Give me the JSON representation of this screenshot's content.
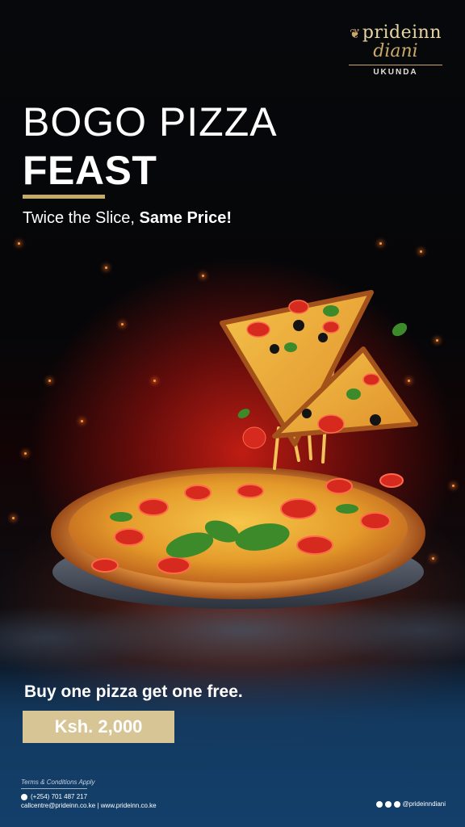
{
  "logo": {
    "brand": "prideinn",
    "sub": "diani",
    "location": "UKUNDA"
  },
  "headline": {
    "line1": "BOGO PIZZA",
    "line2": "FEAST"
  },
  "tagline": {
    "regular": "Twice the Slice, ",
    "bold": "Same Price!"
  },
  "offer": {
    "text": "Buy one pizza get one free.",
    "price": "Ksh. 2,000"
  },
  "footer": {
    "terms": "Terms & Conditions Apply",
    "phone": "(+254) 701 487 217",
    "contacts": "callcentre@prideinn.co.ke | www.prideinn.co.ke",
    "social_handle": "@prideinndiani"
  },
  "colors": {
    "gold": "#c7a96a",
    "price_bg": "#d8c596",
    "footer_blue": "#133f6a"
  },
  "icons": [
    "leaf-icon",
    "whatsapp-icon",
    "youtube-icon",
    "instagram-icon",
    "facebook-icon"
  ]
}
